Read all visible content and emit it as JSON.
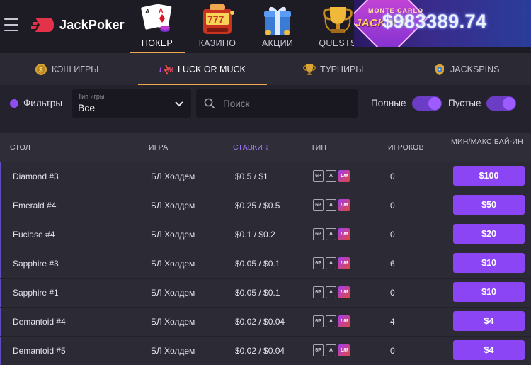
{
  "brand": {
    "name": "JackPoker"
  },
  "nav": [
    {
      "label": "ПОКЕР",
      "icon": "cards-icon",
      "active": true
    },
    {
      "label": "КАЗИНО",
      "icon": "slot-machine-icon",
      "active": false
    },
    {
      "label": "АКЦИИ",
      "icon": "gift-icon",
      "active": false
    },
    {
      "label": "QUESTS",
      "icon": "trophy-icon",
      "active": false
    }
  ],
  "jackpot": {
    "top_text": "MONTE CARLO",
    "word": "JACKPOT",
    "amount": "$983389.74"
  },
  "subtabs": [
    {
      "label": "КЭШ ИГРЫ",
      "icon": "dollar-coin-icon",
      "active": false
    },
    {
      "label": "LUCK OR MUCK",
      "icon": "luck-or-muck-icon",
      "active": true
    },
    {
      "label": "ТУРНИРЫ",
      "icon": "cup-icon",
      "active": false
    },
    {
      "label": "JACKSPINS",
      "icon": "jackspins-icon",
      "active": false
    }
  ],
  "filters": {
    "label": "Фильтры",
    "game_type_caption": "Тип игры",
    "game_type_value": "Все",
    "search_placeholder": "Поиск",
    "full_label": "Полные",
    "empty_label": "Пустые"
  },
  "table": {
    "headers": {
      "table": "СТОЛ",
      "game": "ИГРА",
      "stakes": "СТАВКИ ↓",
      "type": "ТИП",
      "players": "ИГРОКОВ",
      "buyin": "МИН/МАКС БАЙ-ИН"
    },
    "rows": [
      {
        "name": "Diamond #3",
        "game": "БЛ Холдем",
        "stakes": "$0.5 / $1",
        "players": "0",
        "buyin": "$100"
      },
      {
        "name": "Emerald #4",
        "game": "БЛ Холдем",
        "stakes": "$0.25 / $0.5",
        "players": "0",
        "buyin": "$50"
      },
      {
        "name": "Euclase #4",
        "game": "БЛ Холдем",
        "stakes": "$0.1 / $0.2",
        "players": "0",
        "buyin": "$20"
      },
      {
        "name": "Sapphire #3",
        "game": "БЛ Холдем",
        "stakes": "$0.05 / $0.1",
        "players": "6",
        "buyin": "$10"
      },
      {
        "name": "Sapphire #1",
        "game": "БЛ Холдем",
        "stakes": "$0.05 / $0.1",
        "players": "0",
        "buyin": "$10"
      },
      {
        "name": "Demantoid #4",
        "game": "БЛ Холдем",
        "stakes": "$0.02 / $0.04",
        "players": "4",
        "buyin": "$4"
      },
      {
        "name": "Demantoid #5",
        "game": "БЛ Холдем",
        "stakes": "$0.02 / $0.04",
        "players": "0",
        "buyin": "$4"
      }
    ],
    "type_badges": {
      "seats": "6P",
      "cards": "A",
      "luck_or_muck": "LM"
    }
  },
  "colors": {
    "accent": "#8c45f5",
    "tab_underline": "#f0a850",
    "sort_header": "#a37cff"
  }
}
